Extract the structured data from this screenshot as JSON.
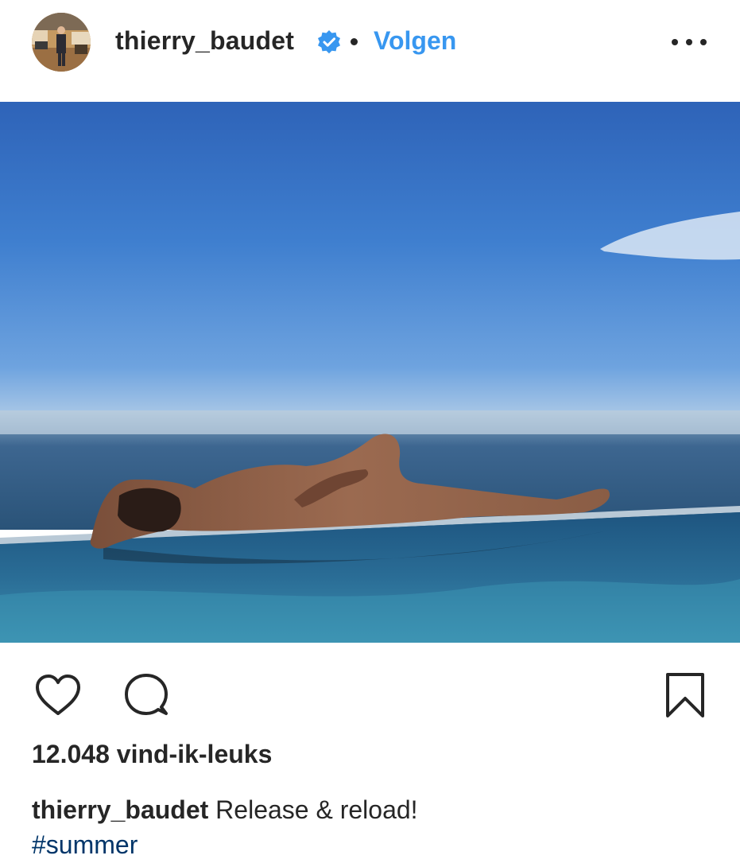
{
  "colors": {
    "link_blue": "#3897f0",
    "hashtag_blue": "#003569",
    "text": "#262626"
  },
  "header": {
    "username": "thierry_baudet",
    "verified": true,
    "follow_label": "Volgen",
    "more_icon": "more-options-icon"
  },
  "post": {
    "image_icons": [
      "like-icon",
      "comment-icon",
      "bookmark-icon"
    ],
    "likes": "12.048 vind-ik-leuks",
    "caption": {
      "username": "thierry_baudet",
      "text": "Release & reload!",
      "hashtag": "#summer"
    }
  }
}
